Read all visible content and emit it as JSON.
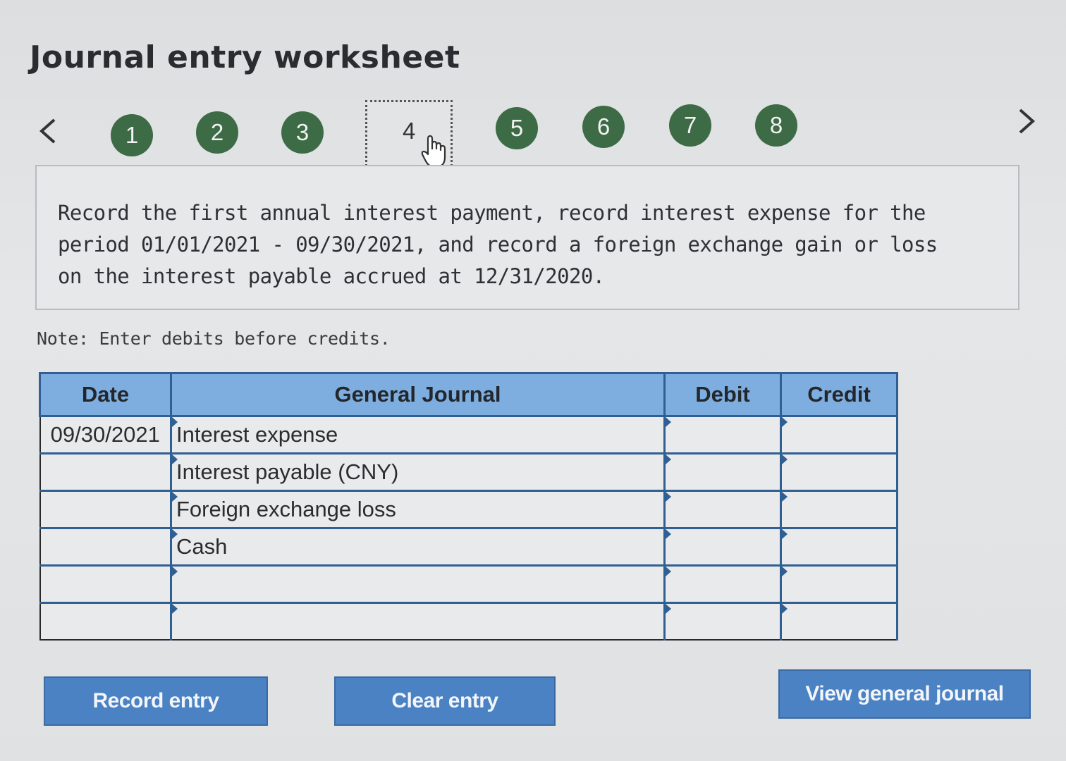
{
  "title": "Journal entry worksheet",
  "steps": {
    "prev_icon": "chevron-left-icon",
    "next_icon": "chevron-right-icon",
    "items": [
      {
        "label": "1",
        "state": "done"
      },
      {
        "label": "2",
        "state": "done"
      },
      {
        "label": "3",
        "state": "done"
      },
      {
        "label": "4",
        "state": "current"
      },
      {
        "label": "5",
        "state": "done"
      },
      {
        "label": "6",
        "state": "done"
      },
      {
        "label": "7",
        "state": "done"
      },
      {
        "label": "8",
        "state": "done"
      }
    ],
    "color_done": "#3d6b45"
  },
  "instruction": {
    "text": "Record the first annual interest payment, record interest expense for the period 01/01/2021 - 09/30/2021, and record a foreign exchange gain or loss on the interest payable accrued at 12/31/2020."
  },
  "note": "Note: Enter debits before credits.",
  "table": {
    "headers": {
      "date": "Date",
      "general_journal": "General Journal",
      "debit": "Debit",
      "credit": "Credit"
    },
    "rows": [
      {
        "date": "09/30/2021",
        "account": "Interest expense",
        "debit": "",
        "credit": ""
      },
      {
        "date": "",
        "account": "Interest payable (CNY)",
        "debit": "",
        "credit": ""
      },
      {
        "date": "",
        "account": "Foreign exchange loss",
        "debit": "",
        "credit": ""
      },
      {
        "date": "",
        "account": "Cash",
        "debit": "",
        "credit": ""
      },
      {
        "date": "",
        "account": "",
        "debit": "",
        "credit": ""
      },
      {
        "date": "",
        "account": "",
        "debit": "",
        "credit": ""
      }
    ],
    "header_color": "#7eaedf",
    "border_color": "#2f5f93"
  },
  "buttons": {
    "record": "Record entry",
    "clear": "Clear entry",
    "view": "View general journal"
  },
  "button_color": "#4a82c3"
}
